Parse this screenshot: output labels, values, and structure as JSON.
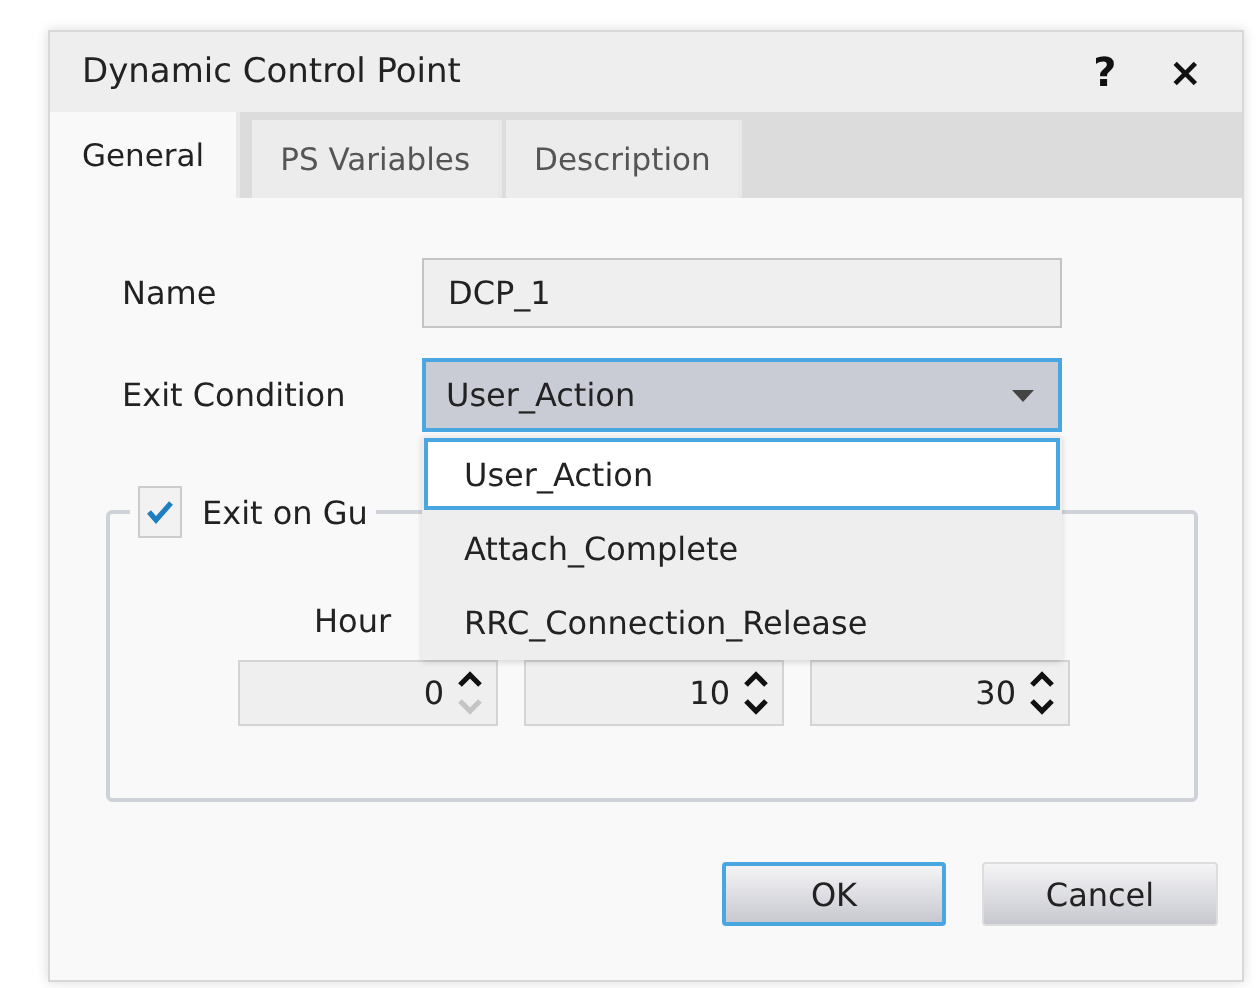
{
  "window": {
    "title": "Dynamic Control Point",
    "help": "?",
    "close": "×"
  },
  "tabs": [
    {
      "label": "General",
      "selected": true
    },
    {
      "label": "PS Variables",
      "selected": false
    },
    {
      "label": "Description",
      "selected": false
    }
  ],
  "name_field": {
    "label": "Name",
    "value": "DCP_1"
  },
  "exit_condition": {
    "label": "Exit Condition",
    "value": "User_Action",
    "expanded": true,
    "options": [
      {
        "label": "User_Action",
        "selected": true
      },
      {
        "label": "Attach_Complete",
        "selected": false
      },
      {
        "label": "RRC_Connection_Release",
        "selected": false
      }
    ]
  },
  "guard": {
    "label": "Exit on Gu",
    "checked": true,
    "column_label": "Hour",
    "spinners": [
      {
        "value": "0",
        "down_disabled": true
      },
      {
        "value": "10",
        "down_disabled": false
      },
      {
        "value": "30",
        "down_disabled": false
      }
    ]
  },
  "buttons": [
    {
      "label": "OK",
      "focused": true
    },
    {
      "label": "Cancel",
      "focused": false
    }
  ]
}
